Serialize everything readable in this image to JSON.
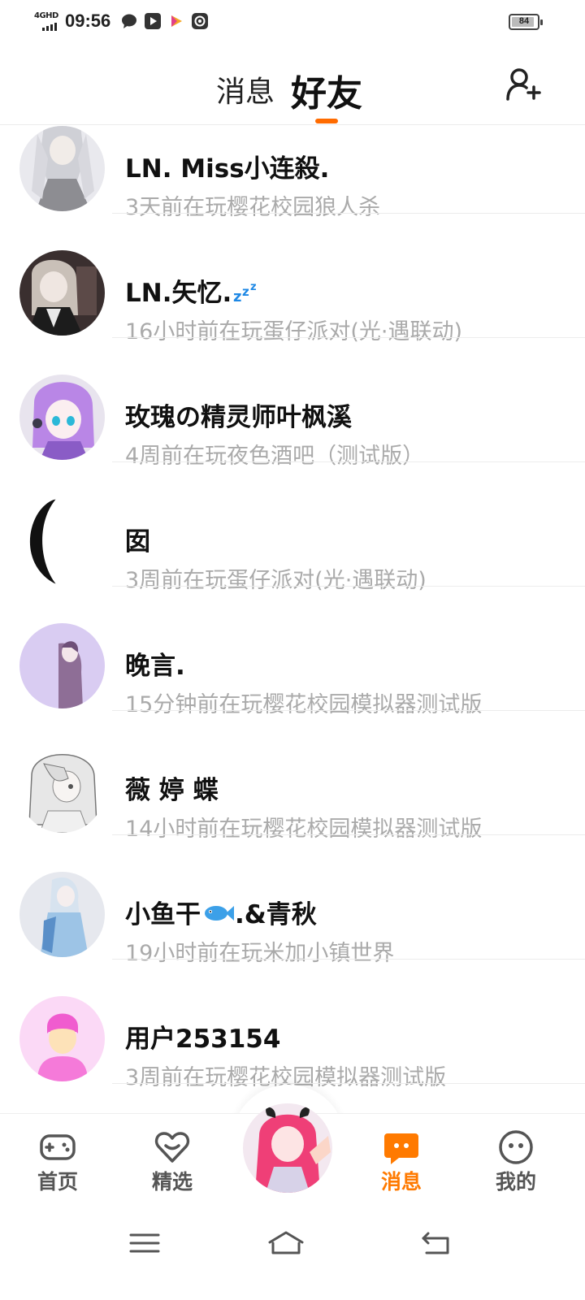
{
  "status_bar": {
    "network": "4GHD",
    "time": "09:56",
    "battery": "84",
    "icons": [
      "chat-bubble-icon",
      "play-store-icon",
      "video-app-icon",
      "browser-app-icon"
    ]
  },
  "header": {
    "tab_messages": "消息",
    "tab_friends": "好友",
    "active_tab": "好友",
    "accent_color": "#ff6b00",
    "add_friend_icon": "add-user-icon"
  },
  "friends": [
    {
      "name": "LN. Miss小连殺.",
      "activity": "3天前在玩樱花校园狼人杀"
    },
    {
      "name": "LN.矢忆.",
      "name_emoji": "💤",
      "activity": "16小时前在玩蛋仔派对(光·遇联动)"
    },
    {
      "name": "玫瑰の精灵师叶枫溪",
      "activity": "4周前在玩夜色酒吧（测试版）"
    },
    {
      "name": "囡",
      "activity": "3周前在玩蛋仔派对(光·遇联动)"
    },
    {
      "name": "晚言.",
      "activity": "15分钟前在玩樱花校园模拟器测试版"
    },
    {
      "name": "薇 婷 蝶",
      "activity": "14小时前在玩樱花校园模拟器测试版"
    },
    {
      "name": "小鱼干",
      "name_emoji": "🐟",
      "name_suffix": ".&青秋",
      "activity": "19小时前在玩米加小镇世界"
    },
    {
      "name": "用户253154",
      "activity": "3周前在玩樱花校园模拟器测试版"
    }
  ],
  "bottom_nav": {
    "items": [
      {
        "label": "首页",
        "icon": "gamepad-icon"
      },
      {
        "label": "精选",
        "icon": "heart-badge-icon"
      },
      {
        "label": "消息",
        "icon": "message-bubble-icon",
        "active": true
      },
      {
        "label": "我的",
        "icon": "smiley-face-icon"
      }
    ],
    "active_color": "#ff7a00"
  },
  "system_nav": {
    "icons": [
      "menu-icon",
      "home-icon",
      "back-icon"
    ]
  }
}
